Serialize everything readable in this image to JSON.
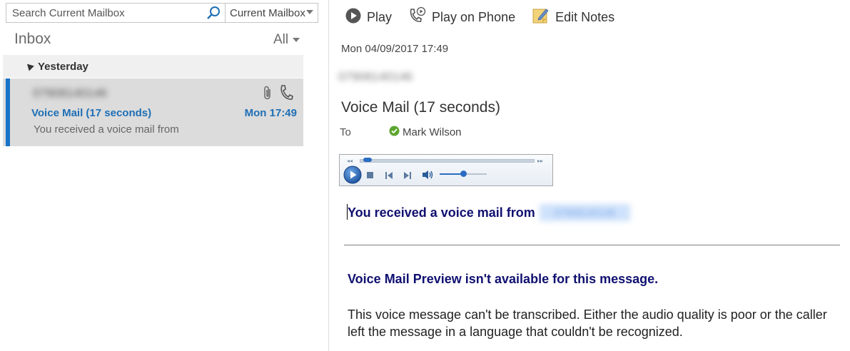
{
  "search": {
    "placeholder": "Search Current Mailbox",
    "scope": "Current Mailbox"
  },
  "folder": {
    "title": "Inbox",
    "filter": "All"
  },
  "group": {
    "label": "Yesterday"
  },
  "message_item": {
    "sender": "07908140146",
    "subject": "Voice Mail (17 seconds)",
    "time": "Mon 17:49",
    "preview": "You received a voice mail from"
  },
  "toolbar": {
    "play_label": "Play",
    "play_on_phone_label": "Play on Phone",
    "edit_notes_label": "Edit Notes"
  },
  "reading": {
    "date": "Mon 04/09/2017 17:49",
    "from": "07908140146",
    "subject": "Voice Mail (17 seconds)",
    "to_label": "To",
    "recipient": "Mark Wilson",
    "body_line1": "You received a voice mail from",
    "caller_number": "07908140146",
    "preview_unavailable": "Voice Mail Preview isn't available for this message.",
    "transcription_note": "This voice message can't be transcribed. Either the audio quality is poor or the caller left the message in a language that couldn't be recognized."
  },
  "player": {
    "seek_fraction": 0.02,
    "volume_fraction": 0.5
  },
  "colors": {
    "accent": "#1874c6",
    "subject_blue": "#1e6fb5",
    "body_navy": "#101070",
    "presence_green": "#5ca52e"
  },
  "icons": [
    "search-icon",
    "attachment-icon",
    "voicemail-phone-icon",
    "play-icon",
    "play-on-phone-icon",
    "edit-notes-icon",
    "presence-available-icon"
  ]
}
